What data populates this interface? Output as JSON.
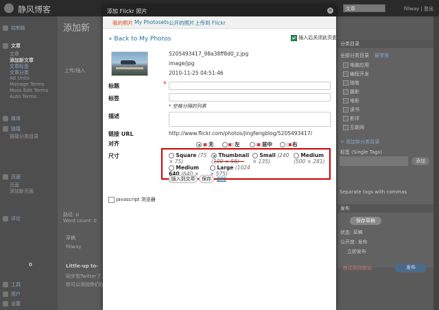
{
  "background": {
    "site_title": "静风博客",
    "user": "fillway | 登出",
    "favorites_select": "文章",
    "page_heading": "添加新",
    "sidebar": {
      "dashboard": "控制板",
      "posts_head": "文章",
      "posts": "文章",
      "add_new": "添加新文章",
      "tags": "文章标签",
      "categories": "文章分类",
      "ad_units": "Ad Units",
      "manage_terms": "Manage Terms",
      "mass_edit": "Mass Edit Terms",
      "auto_terms": "Auto Terms",
      "media": "媒体",
      "links": "链接",
      "link_cats": "链接分类目录",
      "pages": "页面",
      "page_items": [
        "页面",
        "添加新页面"
      ],
      "comments": "评论",
      "comment_count": "0",
      "tools": "工具",
      "users": "用户",
      "settings": "设置"
    },
    "editor_upload": "上传/插入",
    "word_count": "Word count: 0",
    "path": "路径: p",
    "draft": "草稿",
    "author_label": "作者",
    "author_select": "fillway",
    "little_tip": "Little-up to-",
    "sync_twitter": "同步到Twitter了",
    "sync_note": "你可以添加你们在",
    "right": {
      "categories_head": "分类目录",
      "all_cats": "全部分类目录",
      "most_used": "最常用",
      "cats": [
        "电脑应用",
        "编程开发",
        "随笔",
        "摄影",
        "电影",
        "读书",
        "影评",
        "互联网"
      ],
      "add_cat": "+ 添加新分类目录",
      "tags_head": "标签 (Single Tags)",
      "add": "添加",
      "separate": "Separate tags with commas",
      "publish_head": "发布",
      "save_draft": "保存草稿",
      "status": "状态: 草稿",
      "visibility": "公开度: 发布",
      "immediately": "立即发布",
      "move_trash": "移动到回收站",
      "publish": "发布"
    }
  },
  "modal": {
    "title": "添加 Flickr 照片",
    "tabs": [
      {
        "label": "我的照片",
        "active": true
      },
      {
        "label": "My Photosets",
        "active": false
      },
      {
        "label": "公开的照片",
        "active": false
      },
      {
        "label": "上传到 Flickr",
        "active": false
      }
    ],
    "back_link": "« Back to My Photos",
    "close_after_insert": "插入后关闭此页面",
    "file": {
      "name": "5205493417_98a38ff8d0_z.jpg",
      "type": "image/jpg",
      "date": "2010-11-25 04:51:46"
    },
    "fields": {
      "title_label": "标题",
      "title_required": "*",
      "tags_label": "标签",
      "tags_hint": "* 空格分隔的列表",
      "desc_label": "描述",
      "url_label": "链接 URL",
      "url_value": "http://www.flickr.com/photos/jingfengblog/5205493417/",
      "align_label": "对齐",
      "size_label": "尺寸"
    },
    "align_options": [
      {
        "label": "无",
        "icon": "none",
        "selected": true
      },
      {
        "label": "左",
        "icon": "left",
        "selected": false
      },
      {
        "label": "居中",
        "icon": "center",
        "selected": false
      },
      {
        "label": "右",
        "icon": "right",
        "selected": false
      }
    ],
    "size_options": [
      {
        "name": "Square",
        "dims": "(75 × 75)",
        "selected": false
      },
      {
        "name": "Thumbnail",
        "dims": "(100 × 56)",
        "selected": true
      },
      {
        "name": "Small",
        "dims": "(240 × 135)",
        "selected": false
      },
      {
        "name": "Medium",
        "dims": "(500 × 281)",
        "selected": false
      },
      {
        "name": "Medium 640",
        "dims": "(640 × 359)",
        "selected": false
      },
      {
        "name": "Large",
        "dims": "(1024 × 575)",
        "selected": false
      }
    ],
    "insert_button": "插入到文章",
    "save_button": "保存",
    "delete_link": "删除",
    "js_browser": "Javascript 浏览器"
  }
}
